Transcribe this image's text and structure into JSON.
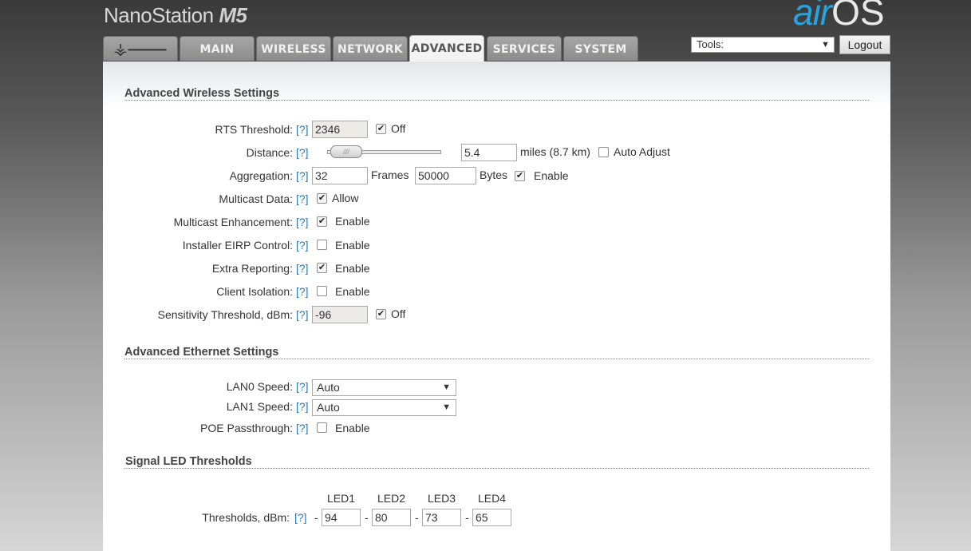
{
  "header": {
    "brand_name": "NanoStation",
    "brand_model": "M5",
    "product_air": "air",
    "product_os": "OS",
    "tools_label": "Tools:",
    "logout_label": "Logout"
  },
  "tabs": [
    {
      "label": "MAIN"
    },
    {
      "label": "WIRELESS"
    },
    {
      "label": "NETWORK"
    },
    {
      "label": "ADVANCED",
      "active": true
    },
    {
      "label": "SERVICES"
    },
    {
      "label": "SYSTEM"
    }
  ],
  "wireless": {
    "title": "Advanced Wireless Settings",
    "help": "[?]",
    "rts": {
      "label": "RTS Threshold:",
      "value": "2346",
      "check": "Off",
      "checked": true
    },
    "distance": {
      "label": "Distance:",
      "value": "5.4",
      "unit": "miles (8.7 km)",
      "auto_label": "Auto Adjust",
      "auto_checked": false
    },
    "aggregation": {
      "label": "Aggregation:",
      "frames": "32",
      "frames_label": "Frames",
      "bytes": "50000",
      "bytes_label": "Bytes",
      "enable": "Enable",
      "checked": true
    },
    "multicast": {
      "label": "Multicast Data:",
      "check": "Allow",
      "checked": true
    },
    "mc_enh": {
      "label": "Multicast Enhancement:",
      "check": "Enable",
      "checked": true
    },
    "eirp": {
      "label": "Installer EIRP Control:",
      "check": "Enable",
      "checked": false
    },
    "extra": {
      "label": "Extra Reporting:",
      "check": "Enable",
      "checked": true
    },
    "isolation": {
      "label": "Client Isolation:",
      "check": "Enable",
      "checked": false
    },
    "sensitivity": {
      "label": "Sensitivity Threshold, dBm:",
      "value": "-96",
      "check": "Off",
      "checked": true
    }
  },
  "ethernet": {
    "title": "Advanced Ethernet Settings",
    "lan0": {
      "label": "LAN0 Speed:",
      "value": "Auto"
    },
    "lan1": {
      "label": "LAN1 Speed:",
      "value": "Auto"
    },
    "poe": {
      "label": "POE Passthrough:",
      "check": "Enable",
      "checked": false
    }
  },
  "led": {
    "title": "Signal LED Thresholds",
    "headers": [
      "LED1",
      "LED2",
      "LED3",
      "LED4"
    ],
    "label": "Thresholds, dBm:",
    "dash": "-",
    "values": [
      "94",
      "80",
      "73",
      "65"
    ]
  },
  "colors": {
    "accent": "#2aa3dc",
    "help_link": "#2a7ab8"
  }
}
